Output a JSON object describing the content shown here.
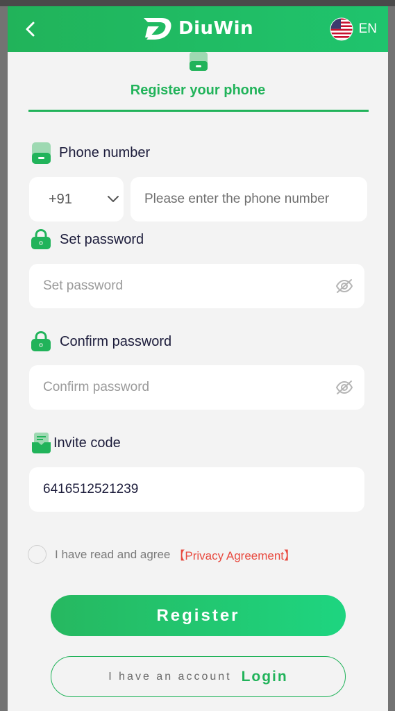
{
  "header": {
    "logo_text": "DiuWin",
    "language": "EN",
    "background_color": "#21b35a"
  },
  "tab": {
    "title": "Register your phone",
    "icon": "phone-icon"
  },
  "phone": {
    "label": "Phone number",
    "country_code": "+91",
    "placeholder": "Please enter the phone number",
    "icon": "phone-icon"
  },
  "password": {
    "label": "Set password",
    "placeholder": "Set password",
    "icon": "lock-icon"
  },
  "confirm": {
    "label": "Confirm password",
    "placeholder": "Confirm password",
    "icon": "lock-icon"
  },
  "invite": {
    "label": "Invite code",
    "value": "6416512521239",
    "icon": "invite-icon"
  },
  "agreement": {
    "text": "I have read and agree",
    "link": "【Privacy Agreement】",
    "link_color": "#e84a3f"
  },
  "actions": {
    "register_label": "Register",
    "have_account_text": "I have an account",
    "login_label": "Login"
  }
}
